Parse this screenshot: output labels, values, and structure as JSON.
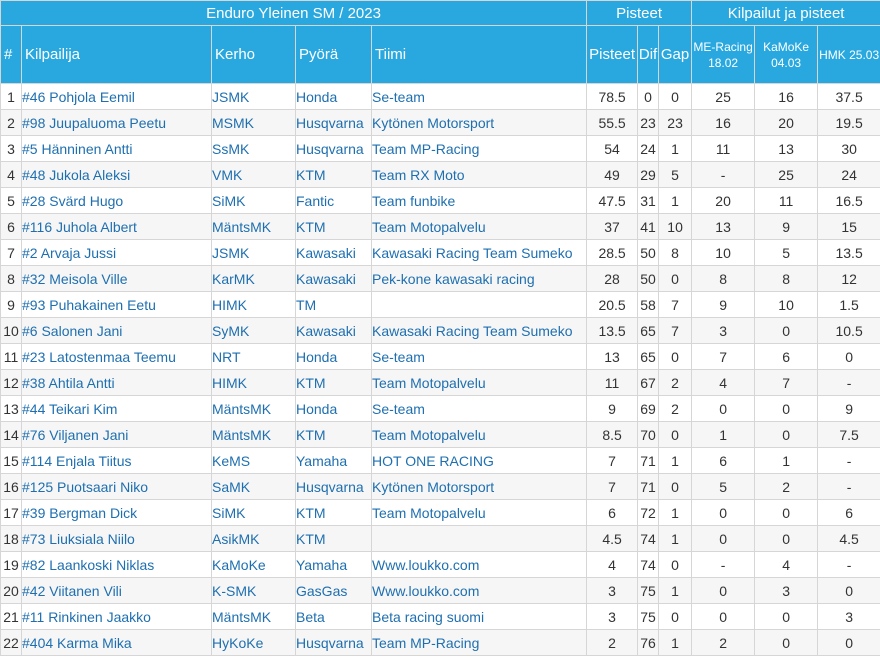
{
  "header": {
    "title": "Enduro Yleinen SM / 2023",
    "points_group": "Pisteet",
    "races_group": "Kilpailut ja pisteet"
  },
  "columns": {
    "num": "#",
    "rider": "Kilpailija",
    "club": "Kerho",
    "bike": "Pyörä",
    "team": "Tiimi",
    "points": "Pisteet",
    "dif": "Dif",
    "gap": "Gap",
    "race1": "ME-Racing 18.02",
    "race2": "KaMoKe 04.03",
    "race3": "HMK 25.03"
  },
  "rows": [
    {
      "pos": "1",
      "rider": "#46 Pohjola Eemil",
      "club": "JSMK",
      "bike": "Honda",
      "team": "Se-team",
      "points": "78.5",
      "dif": "0",
      "gap": "0",
      "r1": "25",
      "r2": "16",
      "r3": "37.5"
    },
    {
      "pos": "2",
      "rider": "#98 Juupaluoma Peetu",
      "club": "MSMK",
      "bike": "Husqvarna",
      "team": "Kytönen Motorsport",
      "points": "55.5",
      "dif": "23",
      "gap": "23",
      "r1": "16",
      "r2": "20",
      "r3": "19.5"
    },
    {
      "pos": "3",
      "rider": "#5 Hänninen Antti",
      "club": "SsMK",
      "bike": "Husqvarna",
      "team": "Team MP-Racing",
      "points": "54",
      "dif": "24",
      "gap": "1",
      "r1": "11",
      "r2": "13",
      "r3": "30"
    },
    {
      "pos": "4",
      "rider": "#48 Jukola Aleksi",
      "club": "VMK",
      "bike": "KTM",
      "team": "Team RX Moto",
      "points": "49",
      "dif": "29",
      "gap": "5",
      "r1": "-",
      "r2": "25",
      "r3": "24"
    },
    {
      "pos": "5",
      "rider": "#28 Svärd Hugo",
      "club": "SiMK",
      "bike": "Fantic",
      "team": "Team funbike",
      "points": "47.5",
      "dif": "31",
      "gap": "1",
      "r1": "20",
      "r2": "11",
      "r3": "16.5"
    },
    {
      "pos": "6",
      "rider": "#116 Juhola Albert",
      "club": "MäntsMK",
      "bike": "KTM",
      "team": "Team Motopalvelu",
      "points": "37",
      "dif": "41",
      "gap": "10",
      "r1": "13",
      "r2": "9",
      "r3": "15"
    },
    {
      "pos": "7",
      "rider": "#2 Arvaja Jussi",
      "club": "JSMK",
      "bike": "Kawasaki",
      "team": "Kawasaki Racing Team Sumeko",
      "points": "28.5",
      "dif": "50",
      "gap": "8",
      "r1": "10",
      "r2": "5",
      "r3": "13.5"
    },
    {
      "pos": "8",
      "rider": "#32 Meisola Ville",
      "club": "KarMK",
      "bike": "Kawasaki",
      "team": "Pek-kone kawasaki racing",
      "points": "28",
      "dif": "50",
      "gap": "0",
      "r1": "8",
      "r2": "8",
      "r3": "12"
    },
    {
      "pos": "9",
      "rider": "#93 Puhakainen Eetu",
      "club": "HIMK",
      "bike": "TM",
      "team": "",
      "points": "20.5",
      "dif": "58",
      "gap": "7",
      "r1": "9",
      "r2": "10",
      "r3": "1.5"
    },
    {
      "pos": "10",
      "rider": "#6 Salonen Jani",
      "club": "SyMK",
      "bike": "Kawasaki",
      "team": "Kawasaki Racing Team Sumeko",
      "points": "13.5",
      "dif": "65",
      "gap": "7",
      "r1": "3",
      "r2": "0",
      "r3": "10.5"
    },
    {
      "pos": "11",
      "rider": "#23 Latostenmaa Teemu",
      "club": "NRT",
      "bike": "Honda",
      "team": "Se-team",
      "points": "13",
      "dif": "65",
      "gap": "0",
      "r1": "7",
      "r2": "6",
      "r3": "0"
    },
    {
      "pos": "12",
      "rider": "#38 Ahtila Antti",
      "club": "HIMK",
      "bike": "KTM",
      "team": "Team Motopalvelu",
      "points": "11",
      "dif": "67",
      "gap": "2",
      "r1": "4",
      "r2": "7",
      "r3": "-"
    },
    {
      "pos": "13",
      "rider": "#44 Teikari Kim",
      "club": "MäntsMK",
      "bike": "Honda",
      "team": "Se-team",
      "points": "9",
      "dif": "69",
      "gap": "2",
      "r1": "0",
      "r2": "0",
      "r3": "9"
    },
    {
      "pos": "14",
      "rider": "#76 Viljanen Jani",
      "club": "MäntsMK",
      "bike": "KTM",
      "team": "Team Motopalvelu",
      "points": "8.5",
      "dif": "70",
      "gap": "0",
      "r1": "1",
      "r2": "0",
      "r3": "7.5"
    },
    {
      "pos": "15",
      "rider": "#114 Enjala Tiitus",
      "club": "KeMS",
      "bike": "Yamaha",
      "team": "HOT ONE RACING",
      "points": "7",
      "dif": "71",
      "gap": "1",
      "r1": "6",
      "r2": "1",
      "r3": "-"
    },
    {
      "pos": "16",
      "rider": "#125 Puotsaari Niko",
      "club": "SaMK",
      "bike": "Husqvarna",
      "team": "Kytönen Motorsport",
      "points": "7",
      "dif": "71",
      "gap": "0",
      "r1": "5",
      "r2": "2",
      "r3": "-"
    },
    {
      "pos": "17",
      "rider": "#39 Bergman Dick",
      "club": "SiMK",
      "bike": "KTM",
      "team": "Team Motopalvelu",
      "points": "6",
      "dif": "72",
      "gap": "1",
      "r1": "0",
      "r2": "0",
      "r3": "6"
    },
    {
      "pos": "18",
      "rider": "#73 Liuksiala Niilo",
      "club": "AsikMK",
      "bike": "KTM",
      "team": "",
      "points": "4.5",
      "dif": "74",
      "gap": "1",
      "r1": "0",
      "r2": "0",
      "r3": "4.5"
    },
    {
      "pos": "19",
      "rider": "#82 Laankoski Niklas",
      "club": "KaMoKe",
      "bike": "Yamaha",
      "team": "Www.loukko.com",
      "points": "4",
      "dif": "74",
      "gap": "0",
      "r1": "-",
      "r2": "4",
      "r3": "-"
    },
    {
      "pos": "20",
      "rider": "#42 Viitanen Vili",
      "club": "K-SMK",
      "bike": "GasGas",
      "team": "Www.loukko.com",
      "points": "3",
      "dif": "75",
      "gap": "1",
      "r1": "0",
      "r2": "3",
      "r3": "0"
    },
    {
      "pos": "21",
      "rider": "#11 Rinkinen Jaakko",
      "club": "MäntsMK",
      "bike": "Beta",
      "team": "Beta racing suomi",
      "points": "3",
      "dif": "75",
      "gap": "0",
      "r1": "0",
      "r2": "0",
      "r3": "3"
    },
    {
      "pos": "22",
      "rider": "#404 Karma Mika",
      "club": "HyKoKe",
      "bike": "Husqvarna",
      "team": "Team MP-Racing",
      "points": "2",
      "dif": "76",
      "gap": "1",
      "r1": "2",
      "r2": "0",
      "r3": "0"
    }
  ],
  "colors": {
    "header_bg": "#29a8e0",
    "header_text": "#ffffff",
    "link": "#1e6fb0",
    "stripe": "#f6f6f6"
  }
}
